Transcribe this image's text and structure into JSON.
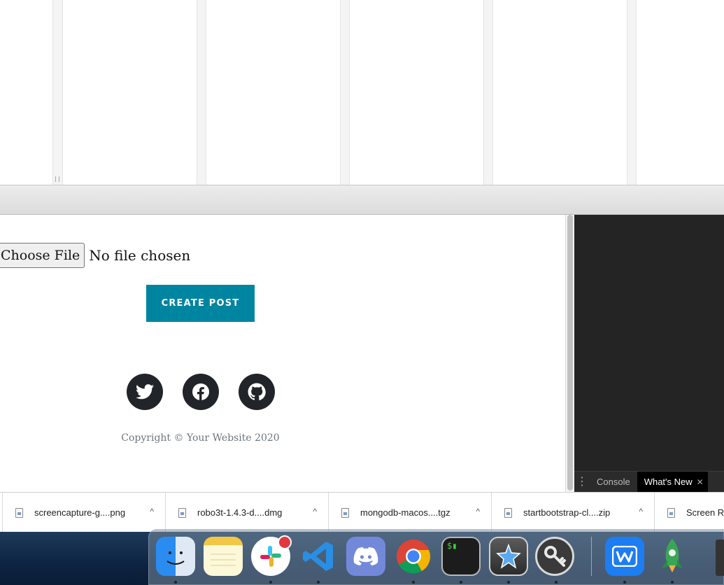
{
  "form": {
    "file_button_label": "Choose File",
    "file_status": "No file chosen",
    "submit_label": "CREATE POST"
  },
  "social": [
    {
      "name": "twitter-icon"
    },
    {
      "name": "facebook-icon"
    },
    {
      "name": "github-icon"
    }
  ],
  "footer": {
    "copyright": "Copyright © Your Website 2020"
  },
  "devtools": {
    "tabs": [
      {
        "label": "Console",
        "active": false
      },
      {
        "label": "What's New",
        "active": true
      }
    ]
  },
  "downloads": [
    {
      "filename": "screencapture-g....png"
    },
    {
      "filename": "robo3t-1.4.3-d....dmg"
    },
    {
      "filename": "mongodb-macos....tgz"
    },
    {
      "filename": "startbootstrap-cl....zip"
    },
    {
      "filename": "Screen R"
    }
  ],
  "dock": [
    {
      "name": "finder-icon"
    },
    {
      "name": "notes-icon"
    },
    {
      "name": "slack-icon",
      "badge": true
    },
    {
      "name": "vscode-icon"
    },
    {
      "name": "discord-icon"
    },
    {
      "name": "chrome-icon"
    },
    {
      "name": "terminal-icon"
    },
    {
      "name": "xcode-instruments-icon"
    },
    {
      "name": "keychain-icon"
    },
    {
      "name": "wps-office-icon"
    },
    {
      "name": "rocket-app-icon"
    }
  ],
  "colors": {
    "accent": "#0085a1",
    "social_bg": "#212529",
    "muted_text": "#6c757d",
    "devtools_bg": "#242424"
  }
}
